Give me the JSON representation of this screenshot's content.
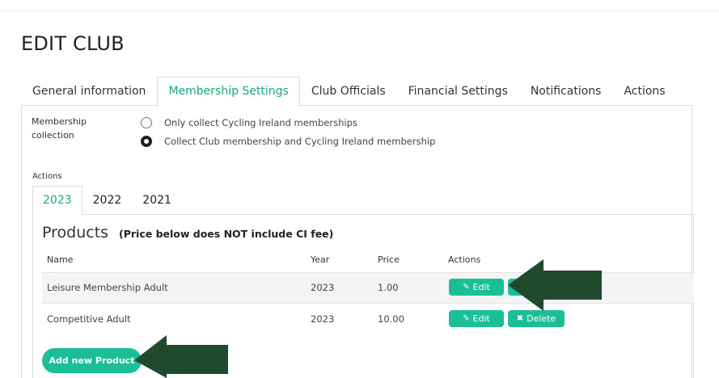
{
  "page": {
    "title": "EDIT CLUB"
  },
  "tabs": [
    {
      "label": "General information"
    },
    {
      "label": "Membership Settings",
      "active": true
    },
    {
      "label": "Club Officials"
    },
    {
      "label": "Financial Settings"
    },
    {
      "label": "Notifications"
    },
    {
      "label": "Actions"
    }
  ],
  "membership_collection": {
    "label": "Membership collection",
    "options": [
      {
        "label": "Only collect Cycling Ireland memberships",
        "checked": false
      },
      {
        "label": "Collect Club membership and Cycling Ireland membership",
        "checked": true
      }
    ]
  },
  "actions_label": "Actions",
  "year_tabs": [
    {
      "label": "2023",
      "active": true
    },
    {
      "label": "2022"
    },
    {
      "label": "2021"
    }
  ],
  "products": {
    "title": "Products",
    "note": "(Price below does NOT include CI fee)",
    "columns": [
      "Name",
      "Year",
      "Price",
      "Actions"
    ],
    "rows": [
      {
        "name": "Leisure Membership Adult",
        "year": "2023",
        "price": "1.00",
        "edit_label": "Edit"
      },
      {
        "name": "Competitive Adult",
        "year": "2023",
        "price": "10.00",
        "edit_label": "Edit",
        "delete_label": "Delete"
      }
    ],
    "add_label": "Add new Product"
  },
  "colors": {
    "accent": "#1aa886",
    "button": "#1bbf97",
    "arrow": "#1f4a2e"
  },
  "icons": {
    "edit": "edit-icon",
    "delete": "delete-icon",
    "annotation": "arrow-left-icon"
  }
}
